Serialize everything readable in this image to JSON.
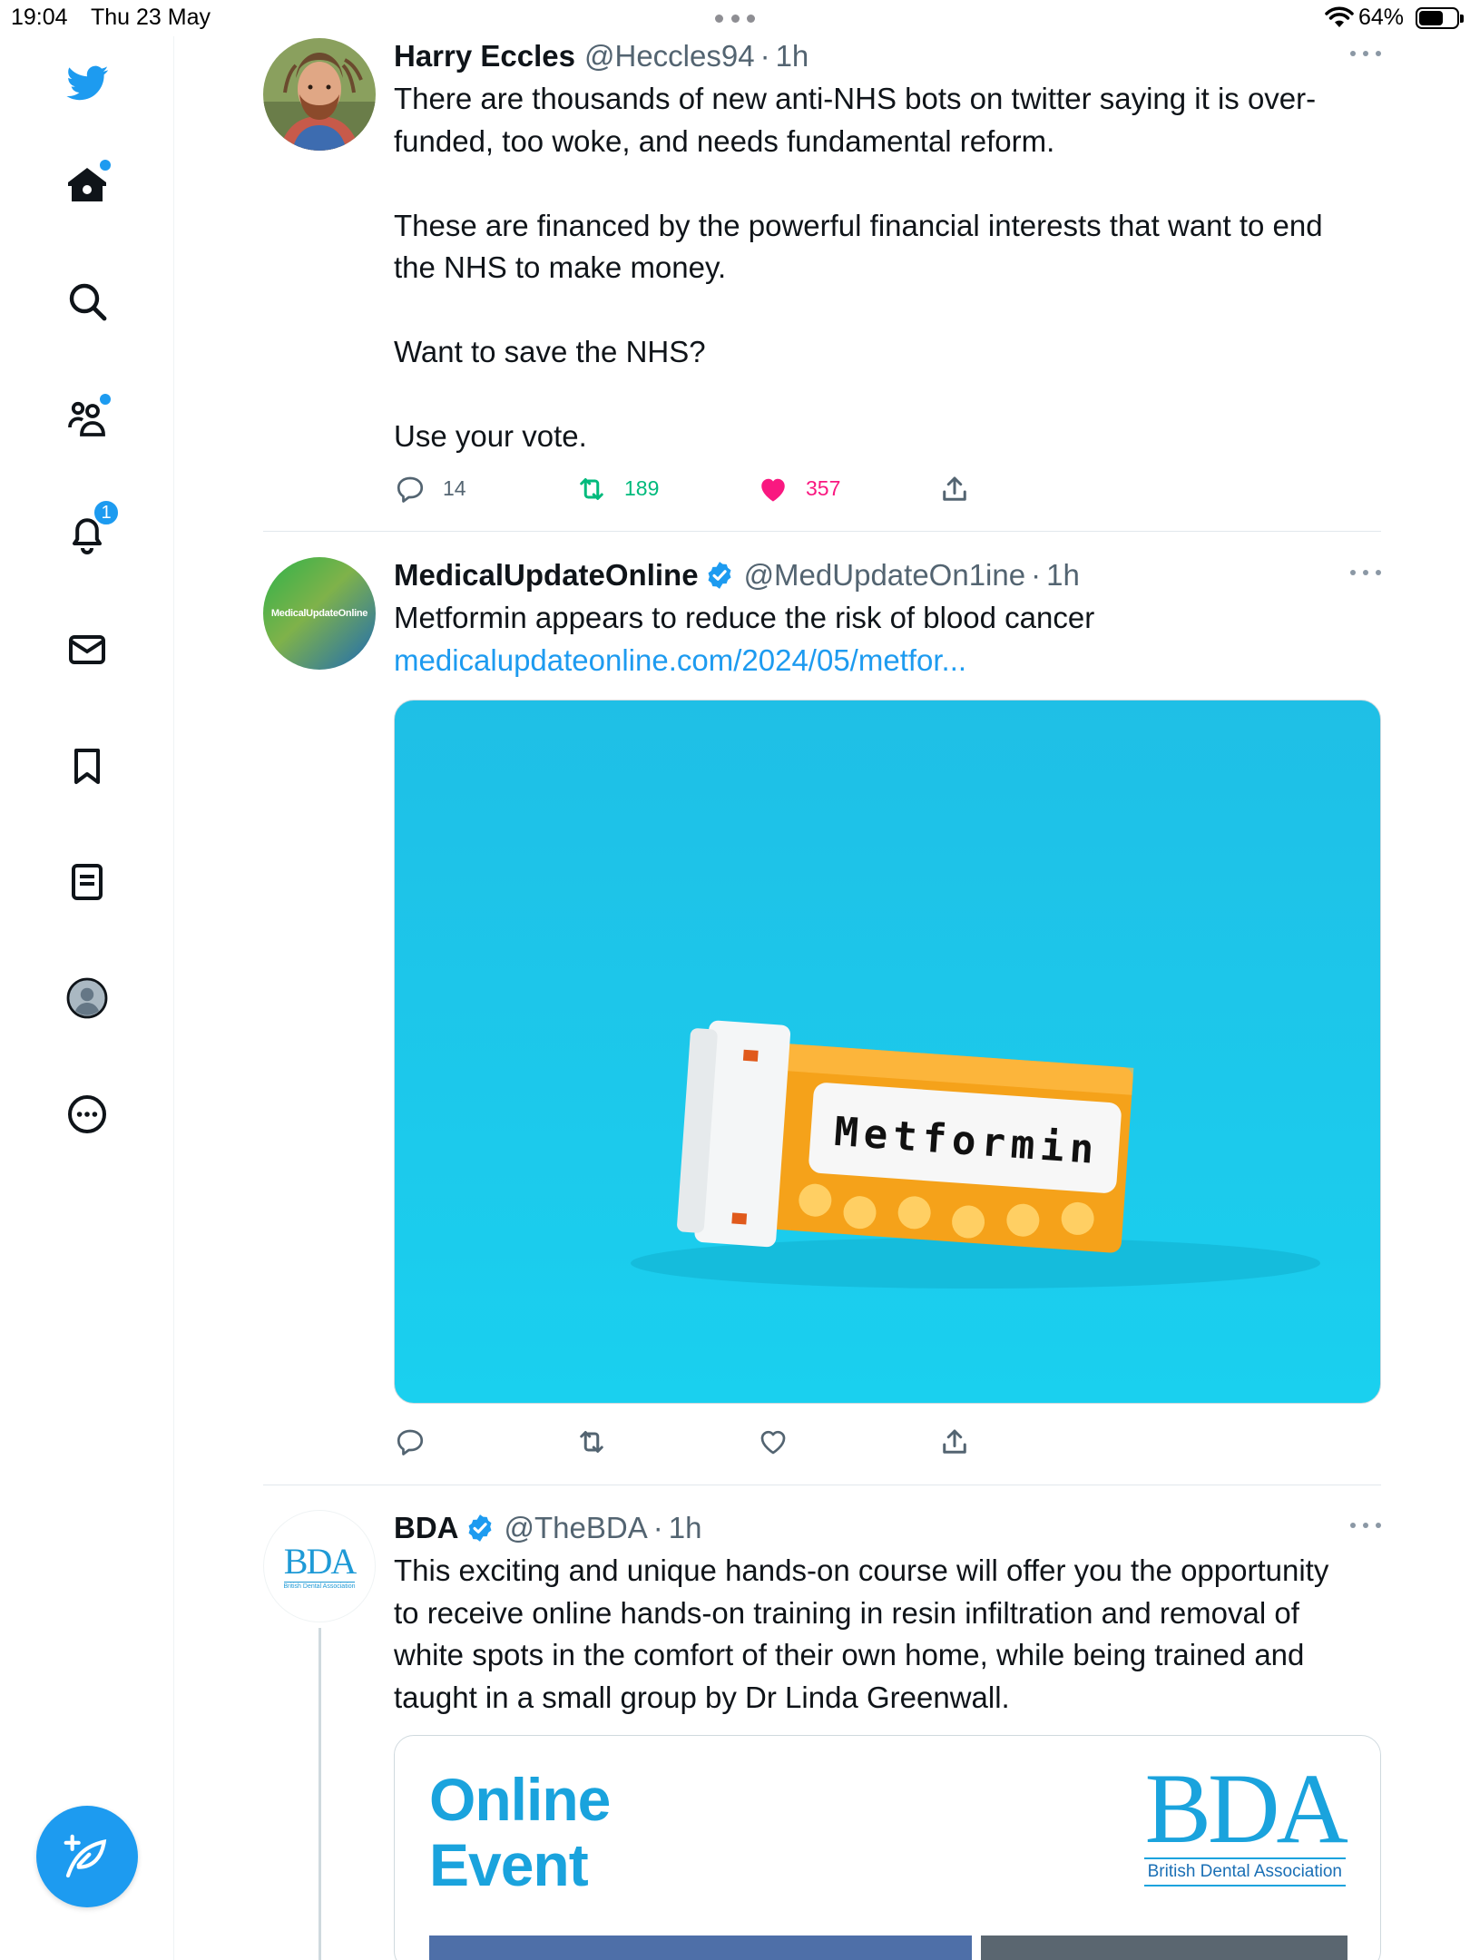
{
  "status_bar": {
    "time": "19:04",
    "date": "Thu 23 May",
    "battery_text": "64%",
    "battery_level": 0.64
  },
  "sidebar": {
    "items": [
      {
        "icon": "twitter-bird-icon"
      },
      {
        "icon": "home-icon",
        "has_dot": true
      },
      {
        "icon": "search-icon"
      },
      {
        "icon": "communities-icon",
        "has_dot": true
      },
      {
        "icon": "notifications-bell-icon",
        "badge": "1"
      },
      {
        "icon": "messages-envelope-icon"
      },
      {
        "icon": "bookmark-icon"
      },
      {
        "icon": "lists-icon"
      },
      {
        "icon": "profile-avatar-icon"
      },
      {
        "icon": "more-circle-icon"
      }
    ],
    "compose_icon": "compose-tweet-icon"
  },
  "accent_color": "#1d9bf0",
  "tweets": [
    {
      "name": "Harry Eccles",
      "handle": "@Heccles94",
      "sep": "·",
      "time": "1h",
      "verified": false,
      "text": "There are thousands of new anti-NHS bots on twitter saying it is over-\nfunded, too woke, and needs fundamental reform.\n\nThese are financed by the powerful financial interests that want to end\nthe NHS to make money.\n\nWant to save the NHS?\n\nUse your vote.",
      "replies": "14",
      "retweets": "189",
      "likes": "357",
      "liked": true
    },
    {
      "name": "MedicalUpdateOnline",
      "handle": "@MedUpdateOn1ine",
      "sep": "·",
      "time": "1h",
      "verified": true,
      "avatar_text": "MedicalUpdateOnline",
      "text": "Metformin appears to reduce the risk of blood cancer",
      "link": "medicalupdateonline.com/2024/05/metfor...",
      "image_label": "Metformin"
    },
    {
      "name": "BDA",
      "handle": "@TheBDA",
      "sep": "·",
      "time": "1h",
      "verified": true,
      "avatar_text": "BDA",
      "avatar_subtext": "British Dental Association",
      "text": "This exciting and unique hands-on course will offer you the opportunity\nto receive online hands-on training in resin infiltration and removal of\nwhite spots in the comfort of their own home, while being trained and\ntaught in a small group by Dr Linda Greenwall.",
      "card": {
        "title_line1": "Online",
        "title_line2": "Event",
        "logo": "BDA",
        "logo_sub": "British Dental Association"
      }
    }
  ]
}
